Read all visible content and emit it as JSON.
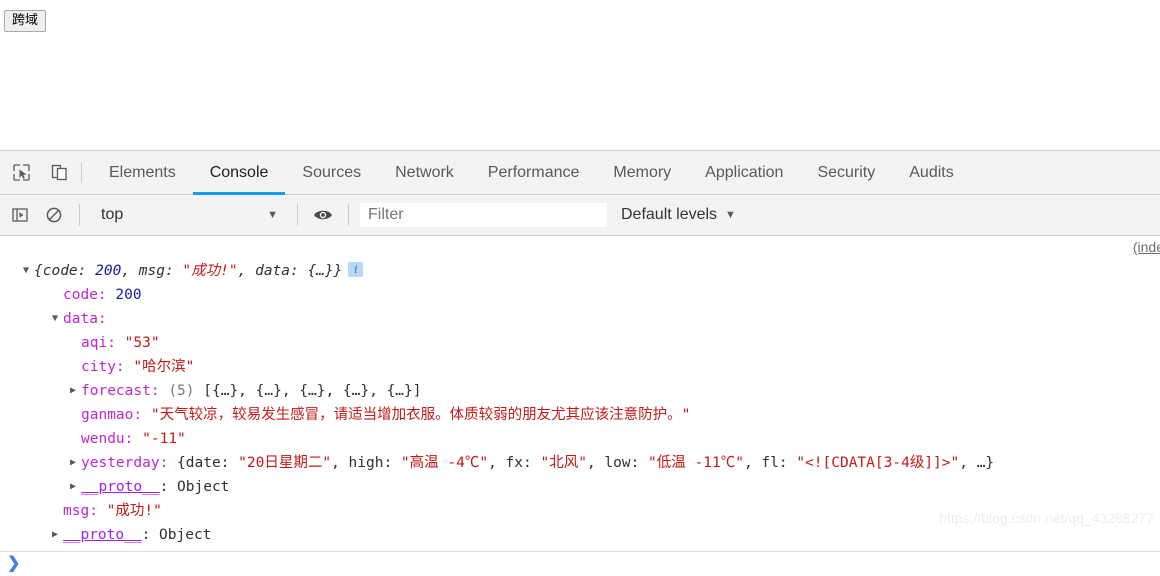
{
  "page": {
    "cors_button_label": "跨域"
  },
  "devtools": {
    "tool_icons": [
      {
        "name": "inspect-element-icon"
      },
      {
        "name": "device-toolbar-icon"
      }
    ],
    "tabs": [
      {
        "label": "Elements",
        "active": false
      },
      {
        "label": "Console",
        "active": true
      },
      {
        "label": "Sources",
        "active": false
      },
      {
        "label": "Network",
        "active": false
      },
      {
        "label": "Performance",
        "active": false
      },
      {
        "label": "Memory",
        "active": false
      },
      {
        "label": "Application",
        "active": false
      },
      {
        "label": "Security",
        "active": false
      },
      {
        "label": "Audits",
        "active": false
      }
    ],
    "console_toolbar": {
      "context_value": "top",
      "context_caret": "▼",
      "filter_placeholder": "Filter",
      "filter_value": "",
      "levels_label": "Default levels",
      "levels_caret": "▼"
    },
    "console": {
      "source_link": "(inde",
      "accent_color": "#1a9bf0",
      "string_color": "#c41a16",
      "number_color": "#1a1aa6",
      "key_color": "#c026d3",
      "info_badge": "i",
      "lines": {
        "root_preview": {
          "prefix": "{code: ",
          "code_value": "200",
          "mid1": ", msg: ",
          "msg_value": "\"成功!\"",
          "mid2": ", data: {…}}"
        },
        "code": {
          "key": "code:",
          "value": "200"
        },
        "data": {
          "key": "data:"
        },
        "aqi": {
          "key": "aqi:",
          "value": "\"53\""
        },
        "city": {
          "key": "city:",
          "value": "\"哈尔滨\""
        },
        "forecast": {
          "key": "forecast:",
          "count": "(5)",
          "value": "[{…}, {…}, {…}, {…}, {…}]"
        },
        "ganmao": {
          "key": "ganmao:",
          "value": "\"天气较凉，较易发生感冒，请适当增加衣服。体质较弱的朋友尤其应该注意防护。\""
        },
        "wendu": {
          "key": "wendu:",
          "value": "\"-11\""
        },
        "yesterday": {
          "key": "yesterday:",
          "p0": "{date: ",
          "v_date": "\"20日星期二\"",
          "p1": ", high: ",
          "v_high": "\"高温 -4℃\"",
          "p2": ", fx: ",
          "v_fx": "\"北风\"",
          "p3": ", low: ",
          "v_low": "\"低温 -11℃\"",
          "p4": ", fl: ",
          "v_fl": "\"<![CDATA[3-4级]]>\"",
          "p5": ", …}"
        },
        "proto_inner": {
          "key": "__proto__",
          "value": ": Object"
        },
        "msg": {
          "key": "msg:",
          "value": "\"成功!\""
        },
        "proto_outer": {
          "key": "__proto__",
          "value": ": Object"
        }
      }
    },
    "prompt": {
      "chevron": "❯"
    }
  },
  "watermark": "https://blog.csdn.net/qq_43288277"
}
